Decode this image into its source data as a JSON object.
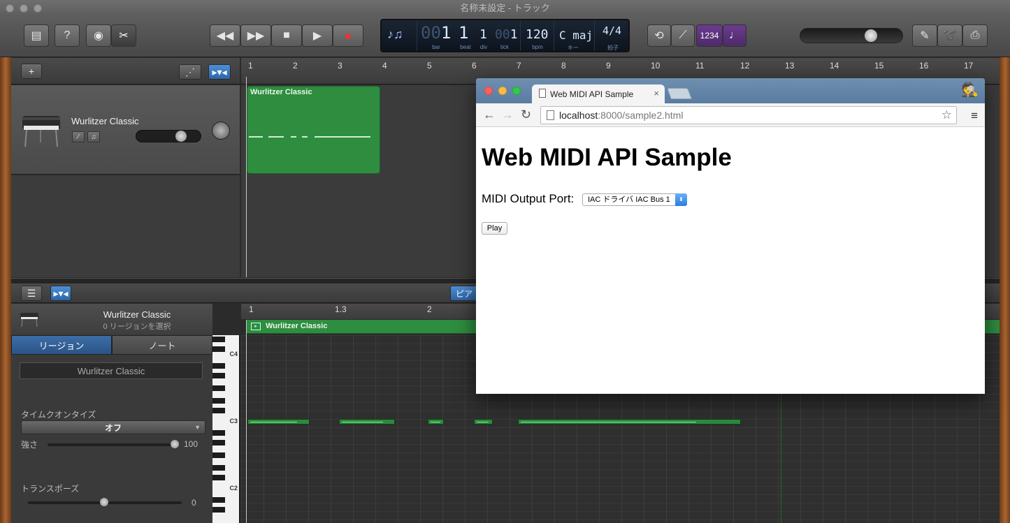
{
  "window": {
    "title": "名称未設定 - トラック"
  },
  "lcd": {
    "bar_dim": "00",
    "bar": "1",
    "beat": "1",
    "div": "1",
    "tick_dim": "00",
    "tick": "1",
    "bpm": "120",
    "key": "C maj",
    "signature": "4/4",
    "labels": {
      "bar": "bar",
      "beat": "beat",
      "div": "div",
      "tick": "tick",
      "bpm": "bpm",
      "key": "キー",
      "signature": "拍子"
    },
    "count_in": "1234"
  },
  "track": {
    "name": "Wurlitzer Classic"
  },
  "ruler_top": [
    "1",
    "2",
    "3",
    "4",
    "5",
    "6",
    "7",
    "8",
    "9",
    "10",
    "11",
    "12",
    "13",
    "14",
    "15",
    "16",
    "17"
  ],
  "region": {
    "name": "Wurlitzer Classic"
  },
  "editor": {
    "tab_partial": "ピア",
    "instrument": "Wurlitzer Classic",
    "selection": "0 リージョンを選択",
    "tabs": [
      "リージョン",
      "ノート"
    ],
    "region_name_field": "Wurlitzer Classic",
    "time_quantize_label": "タイムクオンタイズ",
    "time_quantize_value": "オフ",
    "strength_label": "強さ",
    "strength_value": "100",
    "transpose_label": "トランスポーズ",
    "transpose_value": "0",
    "ruler": [
      "1",
      "1.3",
      "2"
    ],
    "key_labels": [
      "C4",
      "C3",
      "C2"
    ]
  },
  "browser": {
    "tab_title": "Web MIDI API Sample",
    "url_host": "localhost",
    "url_rest": ":8000/sample2.html",
    "heading": "Web MIDI API Sample",
    "output_label": "MIDI Output Port:",
    "output_selected": "IAC ドライバ IAC Bus 1",
    "play_label": "Play"
  },
  "colors": {
    "region_green": "#2e8d3f",
    "browser_tabbar": "#6f8fb0",
    "select_blue": "#2a7ce3"
  }
}
